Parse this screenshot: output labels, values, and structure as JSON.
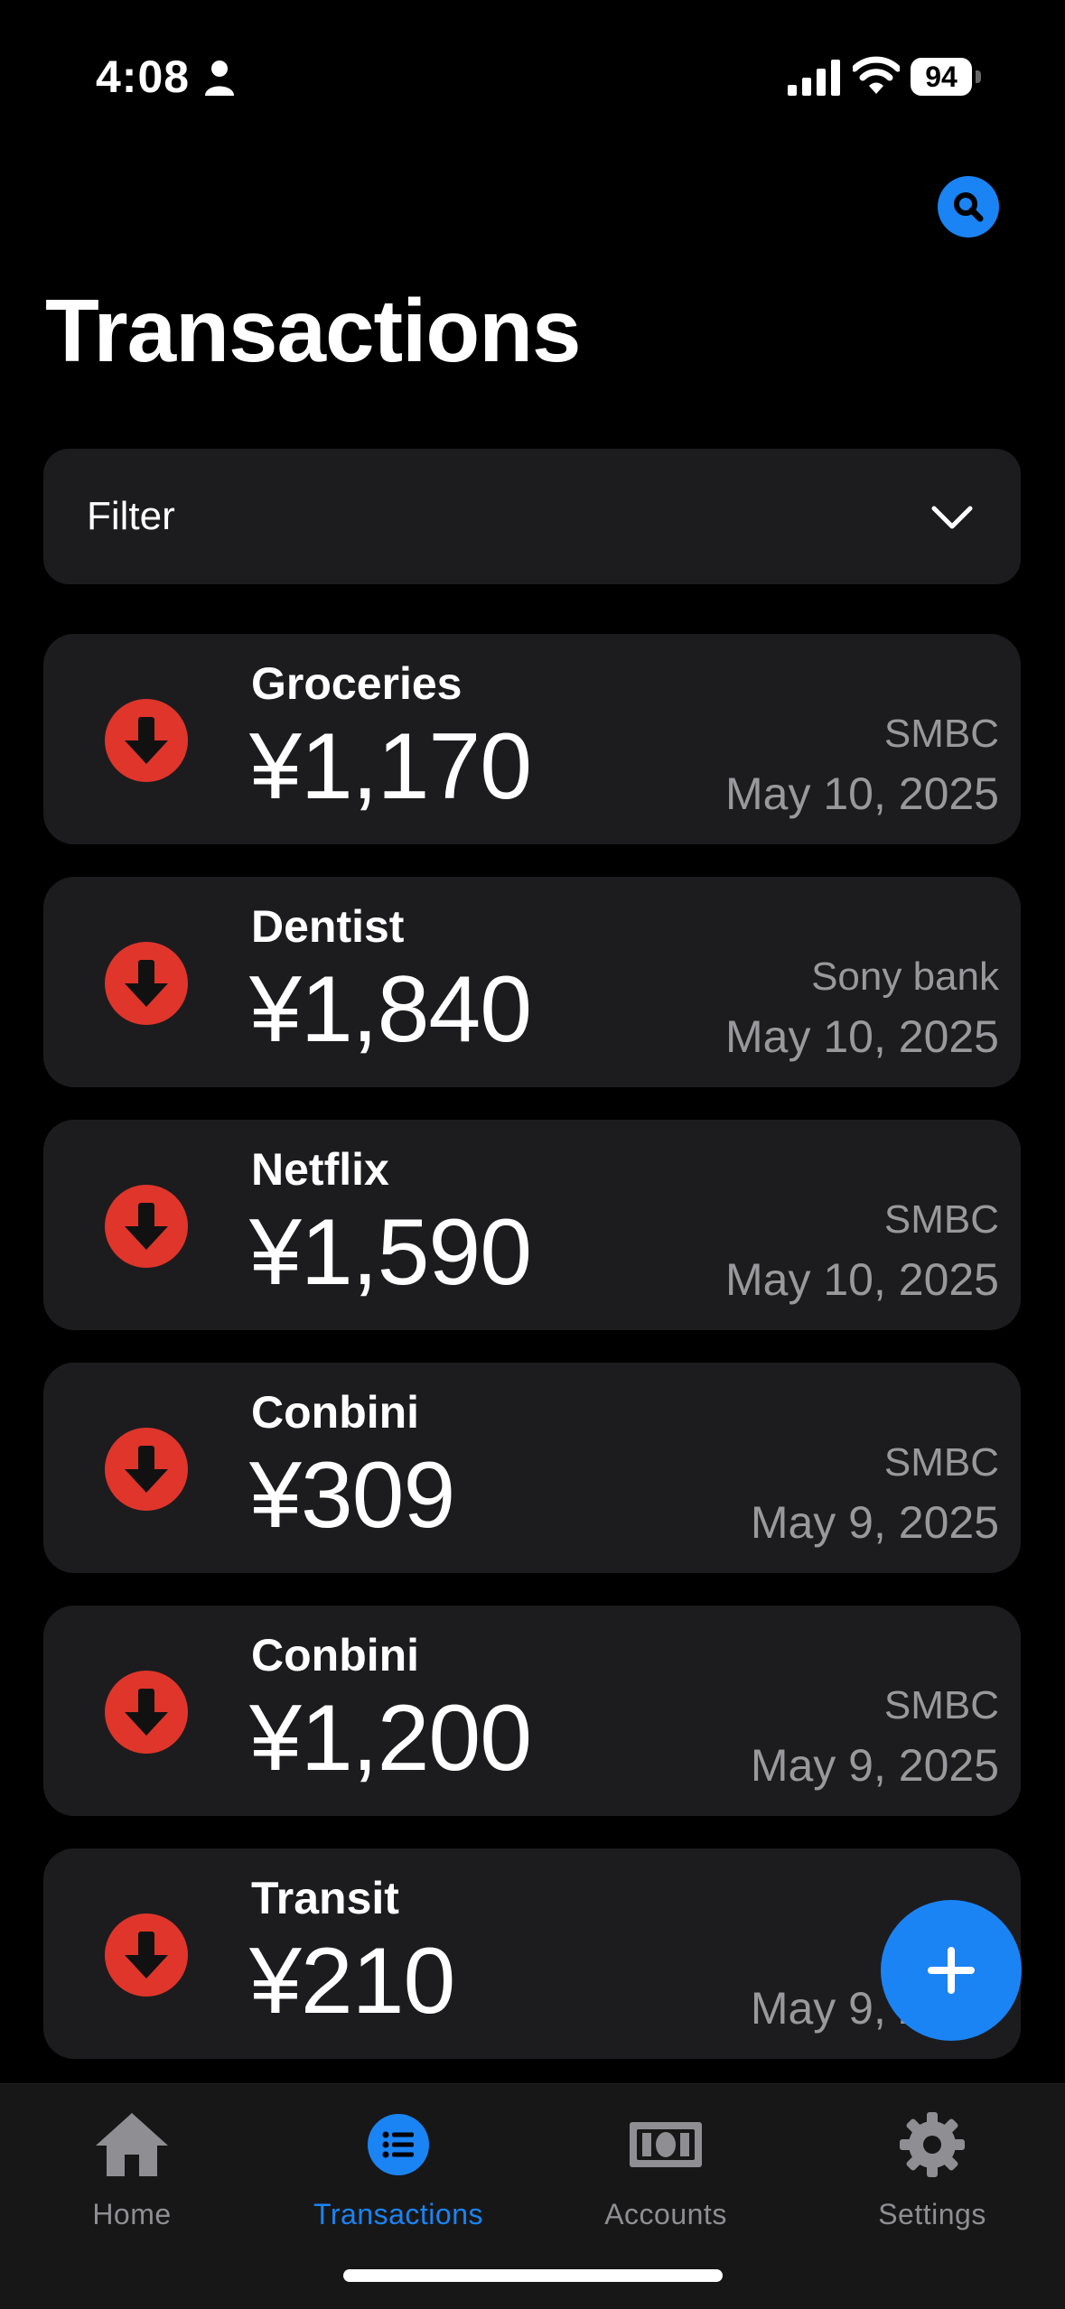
{
  "status": {
    "time": "4:08",
    "battery": "94"
  },
  "header": {
    "title": "Transactions",
    "search_icon": "search-icon"
  },
  "filter": {
    "label": "Filter"
  },
  "transactions": [
    {
      "category": "Groceries",
      "amount": "¥1,170",
      "account": "SMBC",
      "date": "May 10, 2025"
    },
    {
      "category": "Dentist",
      "amount": "¥1,840",
      "account": "Sony bank",
      "date": "May 10, 2025"
    },
    {
      "category": "Netflix",
      "amount": "¥1,590",
      "account": "SMBC",
      "date": "May 10, 2025"
    },
    {
      "category": "Conbini",
      "amount": "¥309",
      "account": "SMBC",
      "date": "May 9, 2025"
    },
    {
      "category": "Conbini",
      "amount": "¥1,200",
      "account": "SMBC",
      "date": "May 9, 2025"
    },
    {
      "category": "Transit",
      "amount": "¥210",
      "account": "",
      "date": "May 9, 2025"
    }
  ],
  "tabs": [
    {
      "label": "Home",
      "icon": "home-icon"
    },
    {
      "label": "Transactions",
      "icon": "list-icon"
    },
    {
      "label": "Accounts",
      "icon": "banknote-icon"
    },
    {
      "label": "Settings",
      "icon": "gear-icon"
    }
  ],
  "colors": {
    "accent": "#1a84f5",
    "expense": "#e0352b",
    "card": "#1c1c1e"
  }
}
